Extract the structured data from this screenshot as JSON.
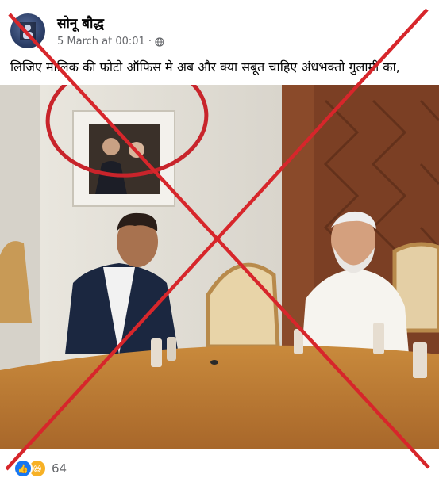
{
  "post": {
    "author": "सोनू बौद्ध",
    "timestamp": "5 March at 00:01",
    "audience_icon": "globe-icon",
    "caption": "लिजिए मालिक की फोटो ऑफिस मे अब और क्या सबूत चाहिए अंधभक्तो गुलामी का,",
    "reactions": {
      "icons": [
        "like-icon",
        "haha-icon"
      ],
      "count": "64"
    }
  },
  "overlay": {
    "cross_color": "#d7262b",
    "circle_color": "#c8242b"
  }
}
